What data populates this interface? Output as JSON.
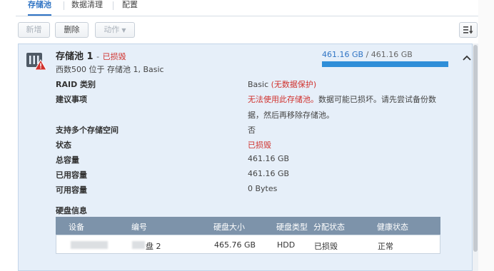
{
  "tabs": [
    {
      "label": "存储池",
      "active": true
    },
    {
      "label": "数据清理",
      "active": false
    },
    {
      "label": "配置",
      "active": false
    }
  ],
  "toolbar": {
    "create_label": "新增",
    "delete_label": "删除",
    "action_label": "动作",
    "sort_icon": "sort-icon"
  },
  "pool": {
    "title": "存储池 1",
    "dash": "-",
    "status": "已损毁",
    "subtitle": "西数500 位于 存储池 1, Basic",
    "capacity_used": "461.16 GB",
    "capacity_sep": "/",
    "capacity_total": "461.16 GB",
    "usage_fraction": 1.0,
    "collapse_icon": "chevron-up-icon"
  },
  "details": {
    "raid_label": "RAID 类别",
    "raid_value": "Basic",
    "raid_note": "(无数据保护)",
    "advice_label": "建议事项",
    "advice_line1": "无法使用此存储池。",
    "advice_line1b": "数据可能已损坏。请先尝试备份数",
    "advice_line2": "据，然后再移除存储池。",
    "multi_label": "支持多个存储空间",
    "multi_value": "否",
    "state_label": "状态",
    "state_value": "已损毁",
    "total_label": "总容量",
    "total_value": "461.16 GB",
    "used_label": "已用容量",
    "used_value": "461.16 GB",
    "avail_label": "可用容量",
    "avail_value": "0 Bytes"
  },
  "disk": {
    "section_title": "硬盘信息",
    "headers": [
      "设备",
      "编号",
      "硬盘大小",
      "硬盘类型",
      "分配状态",
      "健康状态"
    ],
    "rows": [
      {
        "number": "盘 2",
        "size": "465.76 GB",
        "type": "HDD",
        "alloc": "已损毁",
        "health": "正常"
      }
    ]
  },
  "colors": {
    "accent": "#2f74c4",
    "error": "#d0312d",
    "ok": "#2e9e3a",
    "panel_bg": "#e6eff9",
    "table_header": "#7d93aa"
  }
}
